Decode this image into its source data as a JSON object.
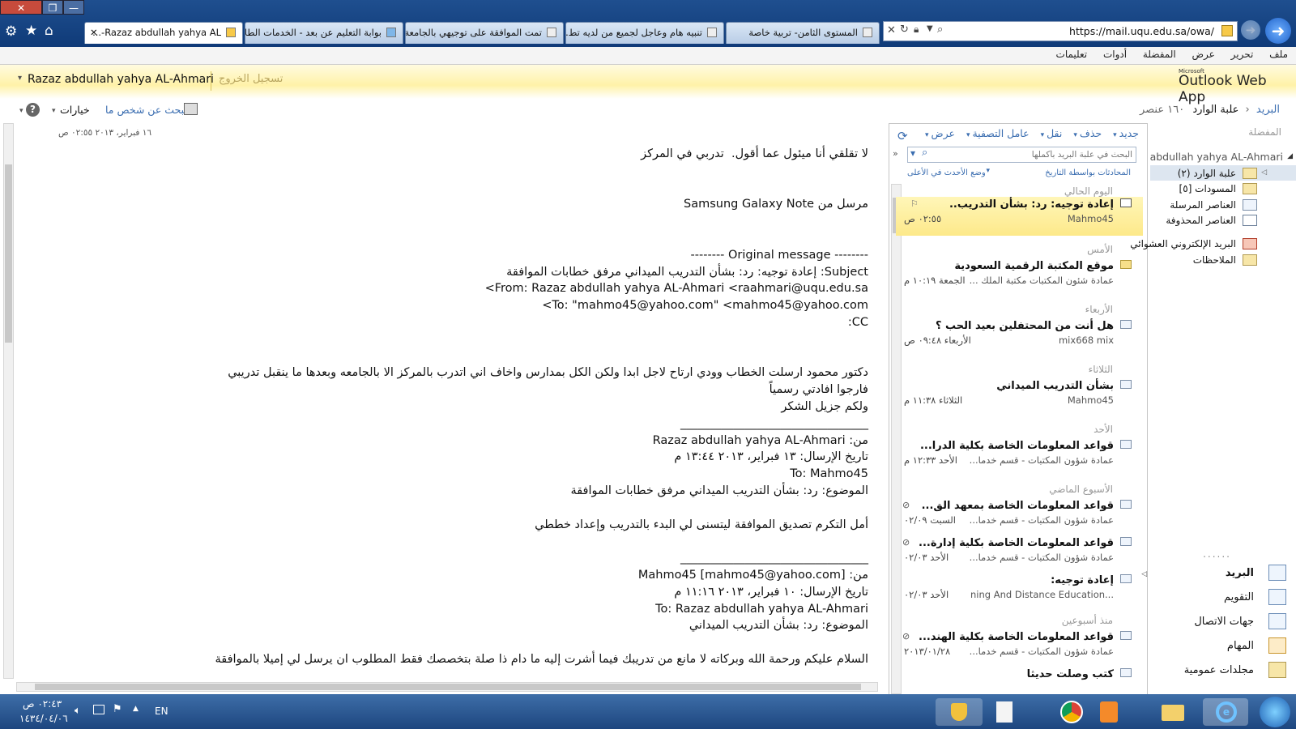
{
  "browser": {
    "tabs": [
      {
        "label": "Razaz abdullah yahya AL-..."
      },
      {
        "label": "بوابة التعليم عن بعد - الخدمات الطلا..."
      },
      {
        "label": "تمت الموافقة على توجيهي بالجامعة"
      },
      {
        "label": "تنبيه هام وعاجل لجميع من لديه تط..."
      },
      {
        "label": "المستوى الثامن- تربية خاصة"
      }
    ],
    "address": "https://mail.uqu.edu.sa/owa/",
    "menu": [
      "ملف",
      "تحرير",
      "عرض",
      "المفضلة",
      "أدوات",
      "تعليمات"
    ]
  },
  "owa": {
    "user_name": "Razaz abdullah yahya AL-Ahmari",
    "signout": "تسجيل الخروج",
    "brand_small": "Microsoft",
    "brand": "Outlook Web App",
    "options": "خيارات",
    "find_someone": "البحث عن شخص ما",
    "help": "?",
    "breadcrumb": {
      "mail": "البريد",
      "inbox": "علبة الوارد",
      "count": "١٦٠ عنصر"
    }
  },
  "nav": {
    "favorites": "المفضلة",
    "account": "abdullah yahya AL-Ahmari",
    "folders": [
      {
        "label": "علبة الوارد (٢)",
        "icon": "inbox-folder-icon"
      },
      {
        "label": "المسودات [٥]",
        "icon": "drafts-folder-icon"
      },
      {
        "label": "العناصر المرسلة",
        "icon": "sent-folder-icon"
      },
      {
        "label": "العناصر المحذوفة",
        "icon": "trash-folder-icon"
      },
      {
        "label": "البريد الإلكتروني العشوائي",
        "icon": "junk-folder-icon"
      },
      {
        "label": "الملاحظات",
        "icon": "notes-folder-icon"
      }
    ],
    "more": "......",
    "sections": [
      {
        "label": "البريد",
        "icon": "mail-icon"
      },
      {
        "label": "التقويم",
        "icon": "calendar-icon"
      },
      {
        "label": "جهات الاتصال",
        "icon": "contacts-icon"
      },
      {
        "label": "المهام",
        "icon": "tasks-icon"
      },
      {
        "label": "مجلدات عمومية",
        "icon": "public-folders-icon"
      }
    ]
  },
  "list": {
    "toolbar": {
      "new": "جديد",
      "delete": "حذف",
      "move": "نقل",
      "filter": "عامل التصفية",
      "view": "عرض"
    },
    "search_placeholder": "البحث في علبة البريد بأكملها",
    "sort_by": "المحادثات بواسطة التاريخ",
    "newest_on_top": "وضع الأحدث في الأعلى",
    "groups": [
      "اليوم الحالي",
      "الأمس",
      "الأربعاء",
      "الثلاثاء",
      "الأحد",
      "الأسبوع الماضي",
      "منذ أسبوعين"
    ],
    "items": [
      {
        "subject": "إعادة توجيه: رد: بشأن التدريب..",
        "from": "Mahmo45",
        "date": "٠٢:٥٥ ص"
      },
      {
        "subject": "موقع المكتبة الرقمية السعودية",
        "from": "عمادة شئون المكتبات مكتبة الملك ...",
        "date": "الجمعة ١٠:١٩ م"
      },
      {
        "subject": "هل أنت من المحتفلين بعيد الحب ؟",
        "from": "mix668 mix",
        "date": "الأربعاء ٠٩:٤٨ ص"
      },
      {
        "subject": "بشأن التدريب الميداني",
        "from": "Mahmo45",
        "date": "الثلاثاء ١١:٣٨ م"
      },
      {
        "subject": "قواعد المعلومات الخاصة بكلية الدرا...",
        "from": "عمادة شؤون المكتبات - قسم خدما...",
        "date": "الأحد ١٢:٣٣ م"
      },
      {
        "subject": "قواعد المعلومات الخاصة بمعهد الق...",
        "from": "عمادة شؤون المكتبات - قسم خدما...",
        "date": "السبت ٠٢/٠٩"
      },
      {
        "subject": "قواعد المعلومات الخاصة بكلية إدارة...",
        "from": "عمادة شؤون المكتبات - قسم خدما...",
        "date": "الأحد ٠٢/٠٣"
      },
      {
        "subject": "إعادة توجيه:",
        "from": "...ning And Distance Education",
        "date": "الأحد ٠٢/٠٣"
      },
      {
        "subject": "قواعد المعلومات الخاصة بكلية الهند...",
        "from": "عمادة شؤون المكتبات - قسم خدما...",
        "date": "٢٠١٣/٠١/٢٨"
      },
      {
        "subject": "كتب وصلت حديثا",
        "from": "",
        "date": ""
      }
    ]
  },
  "message": {
    "date": "١٦ فبراير، ٢٠١٣ ٠٢:٥٥ ص",
    "lines": [
      "لا تقلقي أنا ميئول عما أقول.  تدربي في المركز",
      "",
      "",
      "مرسل من Samsung Galaxy Note",
      "",
      "",
      "-------- Original message --------",
      "Subject: إعادة توجيه: رد: بشأن التدريب الميداني مرفق خطابات الموافقة",
      "From: Razaz abdullah yahya AL-Ahmari <raahmari@uqu.edu.sa>",
      "To: \"mahmo45@yahoo.com\" <mahmo45@yahoo.com>",
      "CC:",
      "",
      "",
      "دكتور محمود ارسلت الخطاب وودي ارتاح لاجل ابدا ولكن الكل بمدارس واخاف اني اتدرب بالمركز الا بالجامعه وبعدها ما ينقبل تدريبي فارجوا افادتي رسمياً",
      "ولكم جزيل الشكر",
      "________________________________",
      "من: Razaz abdullah yahya AL-Ahmari",
      "تاريخ الإرسال: ١٣ فبراير، ٢٠١٣ ١٣:٤٤ م",
      "To: Mahmo45",
      "الموضوع: رد: بشأن التدريب الميداني مرفق خطابات الموافقة",
      "",
      "أمل التكرم تصديق الموافقة ليتسنى لي البدء بالتدريب وإعداد خططي",
      "",
      "________________________________",
      "من: Mahmo45 [mahmo45@yahoo.com]",
      "تاريخ الإرسال: ١٠ فبراير، ٢٠١٣ ١١:١٦ م",
      "To: Razaz abdullah yahya AL-Ahmari",
      "الموضوع: رد: بشأن التدريب الميداني",
      "",
      "السلام عليكم ورحمة الله وبركاته لا مانع من تدريبك فيما أشرت إليه ما دام ذا صلة بتخصصك فقط المطلوب ان يرسل لي إميلا بالموافقة"
    ]
  },
  "taskbar": {
    "time": "٠٢:٤٣ ص",
    "date": "١٤٣٤/٠٤/٠٦",
    "lang": "EN"
  }
}
